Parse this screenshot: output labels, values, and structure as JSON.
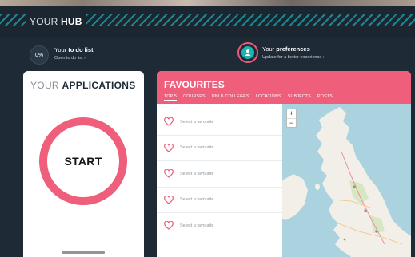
{
  "header": {
    "title_light": "YOUR",
    "title_bold": "HUB"
  },
  "todo": {
    "percent": "0%",
    "title_prefix": "Your",
    "title_bold": "to do list",
    "link": "Open to do list"
  },
  "preferences": {
    "title_prefix": "Your",
    "title_bold": "preferences",
    "link": "Update for a better experience"
  },
  "applications": {
    "title_light": "YOUR",
    "title_bold": "APPLICATIONS",
    "start_label": "START"
  },
  "favourites": {
    "title": "FAVOURITES",
    "tabs": [
      "TOP 5",
      "COURSES",
      "UNI & COLLEGES",
      "LOCATIONS",
      "SUBJECTS",
      "POSTS"
    ],
    "items": [
      {
        "label": "Select a favourite"
      },
      {
        "label": "Select a favourite"
      },
      {
        "label": "Select a favourite"
      },
      {
        "label": "Select a favourite"
      },
      {
        "label": "Select a favourite"
      }
    ]
  },
  "map": {
    "zoom_in": "+",
    "zoom_out": "−"
  },
  "colors": {
    "background": "#1e2a36",
    "accent_pink": "#ef5f7c",
    "accent_teal": "#1aa9b0",
    "card": "#ffffff"
  }
}
